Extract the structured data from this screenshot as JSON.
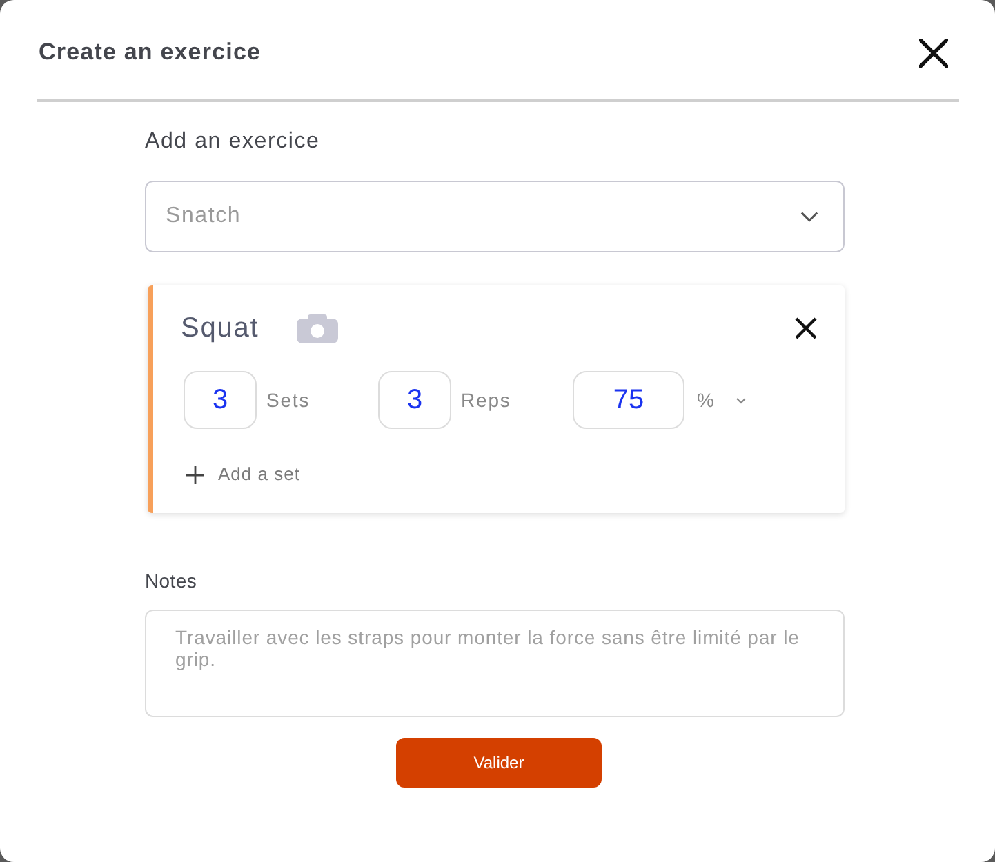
{
  "dialog": {
    "title": "Create an exercice"
  },
  "exercise_picker": {
    "label": "Add an exercice",
    "placeholder": "Snatch"
  },
  "exercise_card": {
    "name": "Squat",
    "fields": [
      {
        "kind": "count",
        "value": "3",
        "unit": "Sets"
      },
      {
        "kind": "count",
        "value": "3",
        "unit": "Reps"
      },
      {
        "kind": "percent",
        "value": "75",
        "unit": "%"
      }
    ],
    "add_set": "Add a set"
  },
  "notes": {
    "label": "Notes",
    "placeholder": "Travailler avec les straps pour monter la force sans être limité par le grip."
  },
  "submit_button": {
    "label": "Valider"
  }
}
